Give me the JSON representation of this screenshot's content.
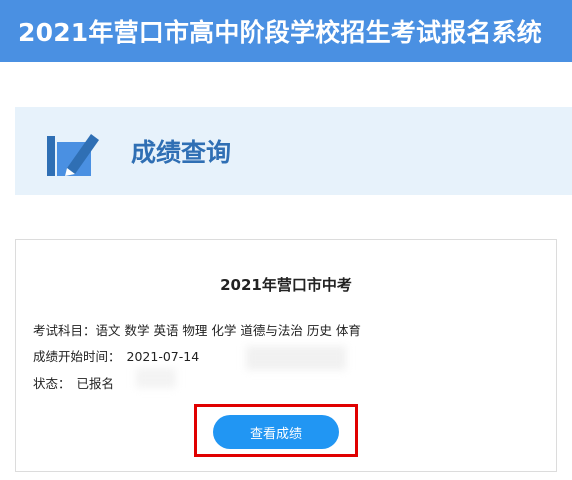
{
  "header": {
    "title": "2021年营口市高中阶段学校招生考试报名系统"
  },
  "section": {
    "title": "成绩查询",
    "icon": "book-pencil-icon"
  },
  "card": {
    "title": "2021年营口市中考",
    "subjects_label": "考试科目：",
    "subjects_value": "语文 数学 英语 物理 化学 道德与法治 历史 体育",
    "start_time_label": "成绩开始时间：",
    "start_time_value": "2021-07-14",
    "status_label": "状态：",
    "status_value": "已报名",
    "button_label": "查看成绩"
  },
  "colors": {
    "header_bg": "#4a90e2",
    "section_bg": "#e7f2fb",
    "section_title": "#2f6fb4",
    "button_bg": "#2196f3",
    "highlight_border": "#e00000"
  }
}
